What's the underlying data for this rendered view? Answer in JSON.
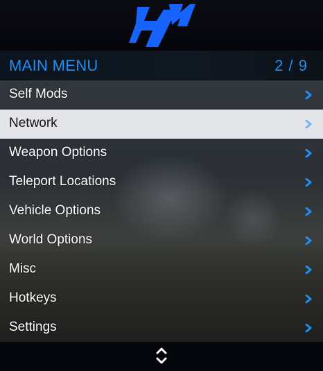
{
  "header": {
    "title": "MAIN MENU",
    "counter": "2 / 9"
  },
  "menu": {
    "items": [
      {
        "label": "Self Mods",
        "icon": "chevron-right-icon"
      },
      {
        "label": "Network",
        "icon": "chevron-right-icon",
        "selected": true
      },
      {
        "label": "Weapon Options",
        "icon": "chevron-right-icon"
      },
      {
        "label": "Teleport Locations",
        "icon": "chevron-right-icon"
      },
      {
        "label": "Vehicle Options",
        "icon": "chevron-right-icon"
      },
      {
        "label": "World Options",
        "icon": "chevron-right-icon"
      },
      {
        "label": "Misc",
        "icon": "chevron-right-icon"
      },
      {
        "label": "Hotkeys",
        "icon": "chevron-right-icon"
      },
      {
        "label": "Settings",
        "icon": "chevron-right-icon"
      }
    ]
  },
  "footer": {
    "icon": "scroll-up-down-icon"
  },
  "colors": {
    "accent": "#1e8ef5",
    "selected_bg": "#e3e5e8",
    "chevron": "#1e8ef5",
    "chevron_selected": "#6fb6f5"
  }
}
